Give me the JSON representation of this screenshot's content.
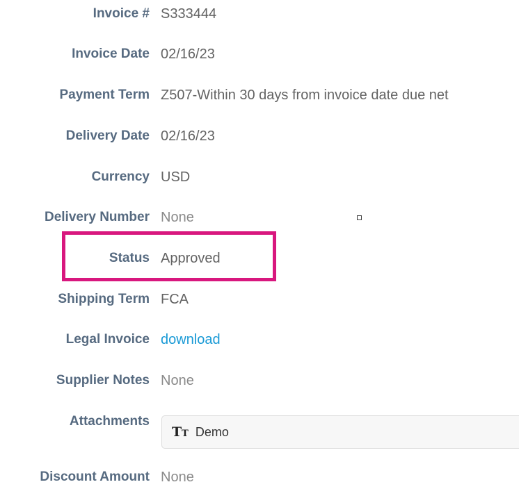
{
  "fields": {
    "invoice_number": {
      "label": "Invoice #",
      "value": "S333444"
    },
    "invoice_date": {
      "label": "Invoice Date",
      "value": "02/16/23"
    },
    "payment_term": {
      "label": "Payment Term",
      "value": "Z507-Within 30 days from invoice date due net"
    },
    "delivery_date": {
      "label": "Delivery Date",
      "value": "02/16/23"
    },
    "currency": {
      "label": "Currency",
      "value": "USD"
    },
    "delivery_number": {
      "label": "Delivery Number",
      "value": "None"
    },
    "status": {
      "label": "Status",
      "value": "Approved"
    },
    "shipping_term": {
      "label": "Shipping Term",
      "value": "FCA"
    },
    "legal_invoice": {
      "label": "Legal Invoice",
      "value": "download"
    },
    "supplier_notes": {
      "label": "Supplier Notes",
      "value": "None"
    },
    "attachments": {
      "label": "Attachments",
      "icon": "text-type-icon",
      "file_name": "Demo"
    },
    "discount_amount": {
      "label": "Discount Amount",
      "value": "None"
    }
  },
  "colors": {
    "label": "#566a80",
    "value": "#636363",
    "muted": "#8a8a8a",
    "link": "#1a9ad6",
    "highlight": "#d8177e"
  }
}
